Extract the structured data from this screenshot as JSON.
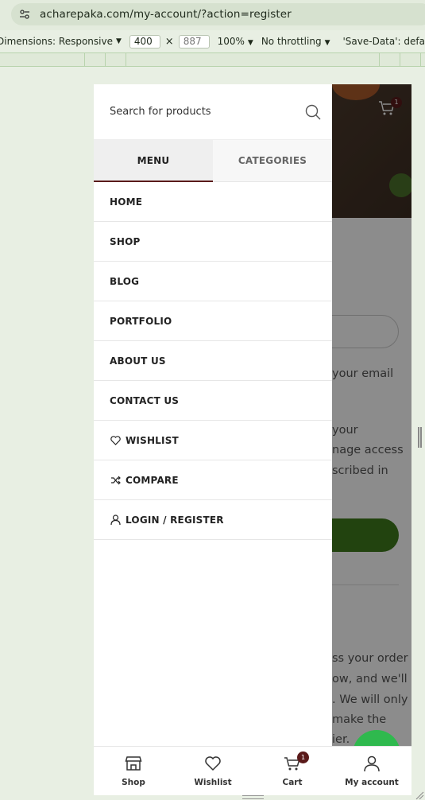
{
  "browser": {
    "url": "acharepaka.com/my-account/?action=register"
  },
  "devtools": {
    "dimensions_label": "Dimensions: Responsive",
    "width": "400",
    "height": "887",
    "zoom": "100%",
    "throttling": "No throttling",
    "save_data": "'Save-Data': defa"
  },
  "header": {
    "cart_count": "1"
  },
  "background_page": {
    "lines": [
      "your email",
      "your",
      "nage access",
      "scribed in",
      "ss your order",
      "ow, and we'll",
      ". We will only",
      "make the",
      "ier."
    ]
  },
  "drawer": {
    "search_placeholder": "Search for products",
    "tabs": [
      {
        "label": "MENU",
        "active": true
      },
      {
        "label": "CATEGORIES",
        "active": false
      }
    ],
    "menu_items": [
      {
        "label": "HOME"
      },
      {
        "label": "SHOP"
      },
      {
        "label": "BLOG"
      },
      {
        "label": "PORTFOLIO"
      },
      {
        "label": "ABOUT US"
      },
      {
        "label": "CONTACT US"
      },
      {
        "label": "WISHLIST",
        "icon": "heart-icon"
      },
      {
        "label": "COMPARE",
        "icon": "shuffle-icon"
      },
      {
        "label": "LOGIN / REGISTER",
        "icon": "user-icon"
      }
    ]
  },
  "bottom_nav": {
    "items": [
      {
        "label": "Shop",
        "icon": "store-icon"
      },
      {
        "label": "Wishlist",
        "icon": "heart-icon"
      },
      {
        "label": "Cart",
        "icon": "cart-icon",
        "badge": "1"
      },
      {
        "label": "My account",
        "icon": "user-icon"
      }
    ]
  },
  "colors": {
    "accent": "#5a1a1a",
    "primary_button": "#3f7a1c",
    "whatsapp": "#2fb94e"
  }
}
